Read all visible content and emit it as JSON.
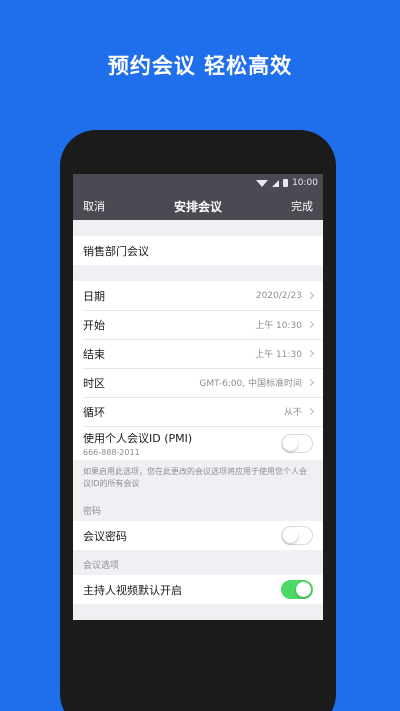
{
  "promo": {
    "title": "预约会议 轻松高效"
  },
  "status": {
    "time": "10:00"
  },
  "nav": {
    "cancel": "取消",
    "title": "安排会议",
    "done": "完成"
  },
  "topic": {
    "value": "销售部门会议"
  },
  "schedule": [
    {
      "label": "日期",
      "value": "2020/2/23"
    },
    {
      "label": "开始",
      "value": "上午 10:30"
    },
    {
      "label": "结束",
      "value": "上午 11:30"
    },
    {
      "label": "时区",
      "value": "GMT-6:00, 中国标准时间"
    },
    {
      "label": "循环",
      "value": "从不"
    }
  ],
  "pmi": {
    "label": "使用个人会议ID (PMI)",
    "number": "666-888-2011",
    "enabled": false
  },
  "pmi_note": "如果启用此选项，您在此更改的会议选项将应用于使用您个人会议ID的所有会议",
  "password": {
    "header": "密码",
    "label": "会议密码",
    "enabled": false
  },
  "options": {
    "header": "会议选项",
    "host_video_label": "主持人视频默认开启",
    "host_video_enabled": true
  },
  "colors": {
    "background": "#1f6fec",
    "navbar": "#4a4a52",
    "toggle_on": "#4cd964"
  },
  "icons": [
    "wifi-icon",
    "signal-icon",
    "battery-icon",
    "chevron-right-icon"
  ]
}
